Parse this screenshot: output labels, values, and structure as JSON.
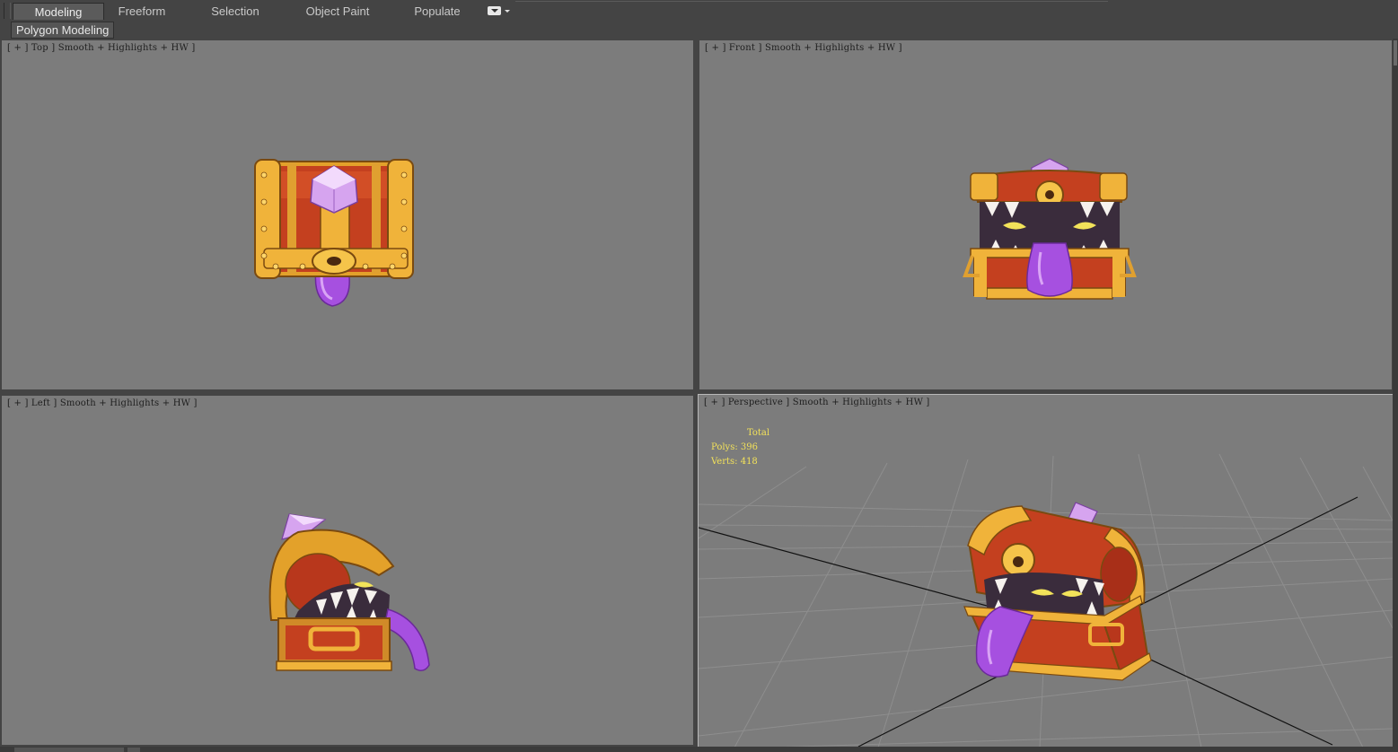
{
  "ribbon": {
    "tabs": [
      {
        "label": "Modeling",
        "active": true
      },
      {
        "label": "Freeform",
        "active": false
      },
      {
        "label": "Selection",
        "active": false
      },
      {
        "label": "Object Paint",
        "active": false
      },
      {
        "label": "Populate",
        "active": false
      }
    ],
    "dropdown_icon": "dropdown-arrow-icon"
  },
  "subribbon": {
    "panel_label": "Polygon Modeling"
  },
  "viewports": {
    "top": {
      "label": "[ + ] Top ] Smooth + Highlights + HW ]"
    },
    "front": {
      "label": "[ + ] Front ] Smooth + Highlights + HW ]"
    },
    "left": {
      "label": "[ + ] Left ] Smooth + Highlights + HW ]"
    },
    "perspective": {
      "label": "[ + ] Perspective ] Smooth + Highlights + HW ]",
      "stats": {
        "title": "Total",
        "polys": "Polys: 396",
        "verts": "Verts: 418"
      }
    }
  },
  "colors": {
    "ui_background": "#444444",
    "viewport_background": "#7c7c7c",
    "stats_text": "#f2e15a",
    "chest_red": "#c4401f",
    "chest_gold": "#e3a12a",
    "gem_purple": "#c98be6",
    "tongue_purple": "#a650e0"
  }
}
